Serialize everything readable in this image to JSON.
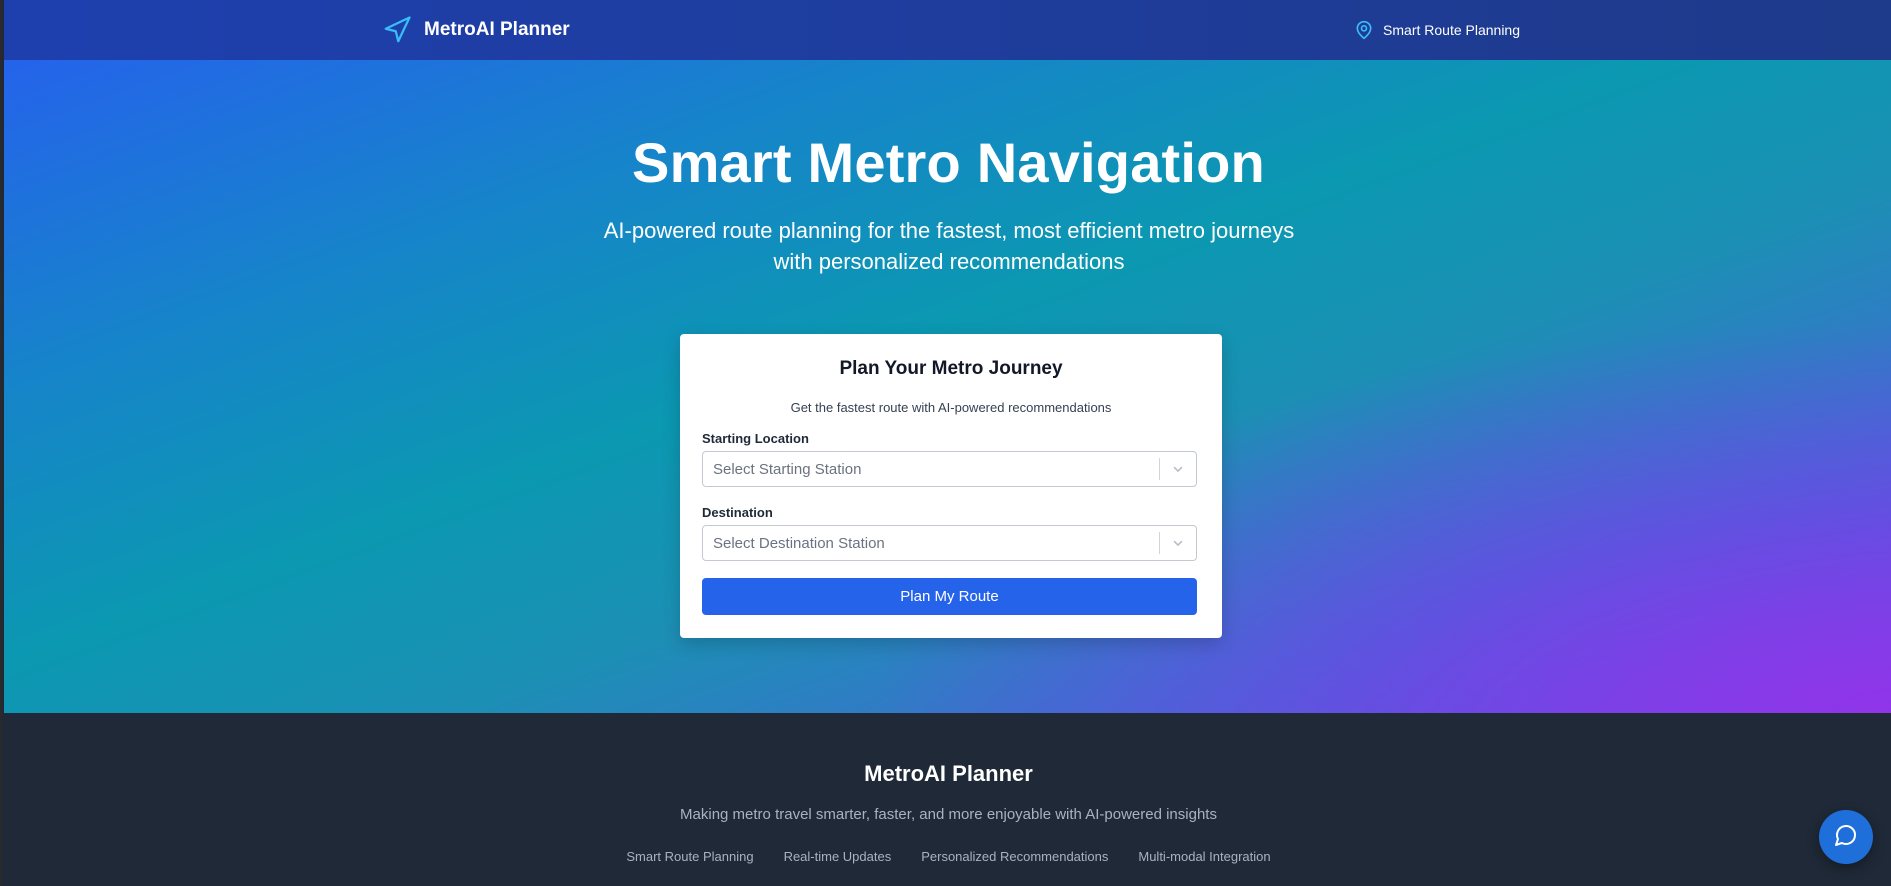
{
  "colors": {
    "header_bg": "#1e3a8a",
    "accent": "#2563eb",
    "icon_cyan": "#38bdf8",
    "footer_bg": "#1f2937",
    "hero_gradient_start": "#2563eb",
    "hero_gradient_mid": "#0b98b1",
    "hero_gradient_end": "#9333ea"
  },
  "header": {
    "brand_icon": "navigation-arrow-icon",
    "brand_title": "MetroAI Planner",
    "link_icon": "map-pin-icon",
    "link_label": "Smart Route Planning"
  },
  "hero": {
    "title": "Smart Metro Navigation",
    "subtitle_line1": "AI-powered route planning for the fastest, most efficient metro journeys",
    "subtitle_line2": "with personalized recommendations"
  },
  "planner": {
    "title": "Plan Your Metro Journey",
    "subtitle": "Get the fastest route with AI-powered recommendations",
    "start_label": "Starting Location",
    "start_placeholder": "Select Starting Station",
    "dest_label": "Destination",
    "dest_placeholder": "Select Destination Station",
    "submit_label": "Plan My Route"
  },
  "footer": {
    "title": "MetroAI Planner",
    "tagline": "Making metro travel smarter, faster, and more enjoyable with AI-powered insights",
    "links": [
      "Smart Route Planning",
      "Real-time Updates",
      "Personalized Recommendations",
      "Multi-modal Integration"
    ]
  },
  "chat": {
    "icon": "chat-bubble-icon"
  }
}
